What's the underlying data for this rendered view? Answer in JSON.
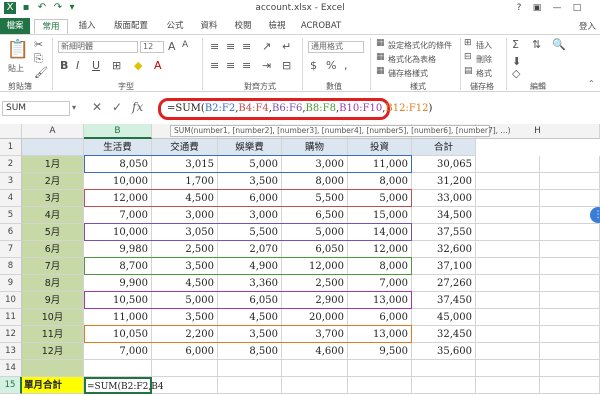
{
  "window": {
    "title": "account.xlsx - Excel",
    "controls": [
      "?",
      "▣",
      "—",
      "□"
    ],
    "signin": "登入"
  },
  "tabs": [
    "檔案",
    "常用",
    "插入",
    "版面配置",
    "公式",
    "資料",
    "校閱",
    "檢視",
    "ACROBAT"
  ],
  "ribbon": {
    "paste": "貼上",
    "font_name": "新細明體",
    "font_size": "12",
    "groups": [
      "剪貼簿",
      "字型",
      "對齊方式",
      "數值",
      "樣式",
      "儲存格",
      "編輯"
    ],
    "number_format": "通用格式",
    "styles": [
      "設定格式化的條件",
      "格式化為表格",
      "儲存格樣式"
    ],
    "cells": [
      "插入",
      "刪除",
      "格式"
    ],
    "edit_items": [
      "Σ",
      "排序與篩選",
      "尋找與選取"
    ]
  },
  "formula_bar": {
    "name_box": "SUM",
    "fx": "fx",
    "formula_parts": [
      {
        "text": "=SUM(",
        "color": "#222222"
      },
      {
        "text": "B2:F2",
        "color": "#3b6cc4"
      },
      {
        "text": ",",
        "color": "#222222"
      },
      {
        "text": "B4:F4",
        "color": "#c0504d"
      },
      {
        "text": ",",
        "color": "#222222"
      },
      {
        "text": "B6:F6",
        "color": "#7b4fb0"
      },
      {
        "text": ",",
        "color": "#222222"
      },
      {
        "text": "B8:F8",
        "color": "#4e9a3a"
      },
      {
        "text": ",",
        "color": "#222222"
      },
      {
        "text": "B10:F10",
        "color": "#9b3aa8"
      },
      {
        "text": ",",
        "color": "#222222"
      },
      {
        "text": "B12:F12",
        "color": "#e07a20"
      },
      {
        "text": ")",
        "color": "#222222"
      }
    ],
    "tooltip": "SUM(number1, [number2], [number3], [number4], [number5], [number6], [number7], ...)"
  },
  "grid": {
    "columns": [
      "A",
      "B",
      "C",
      "D",
      "E",
      "F",
      "G",
      "H"
    ],
    "selected_column": "B",
    "header": [
      "生活費",
      "交通費",
      "娛樂費",
      "購物",
      "投資",
      "合計"
    ],
    "rows": [
      {
        "label": "1月",
        "values": [
          "8,050",
          "3,015",
          "5,000",
          "3,000",
          "11,000",
          "30,065"
        ]
      },
      {
        "label": "2月",
        "values": [
          "10,000",
          "1,700",
          "3,500",
          "8,000",
          "8,000",
          "31,200"
        ]
      },
      {
        "label": "3月",
        "values": [
          "12,000",
          "4,500",
          "6,000",
          "5,500",
          "5,000",
          "33,000"
        ]
      },
      {
        "label": "4月",
        "values": [
          "7,000",
          "3,000",
          "3,000",
          "6,500",
          "15,000",
          "34,500"
        ]
      },
      {
        "label": "5月",
        "values": [
          "10,000",
          "3,050",
          "5,500",
          "5,000",
          "14,000",
          "37,550"
        ]
      },
      {
        "label": "6月",
        "values": [
          "9,980",
          "2,500",
          "2,070",
          "6,050",
          "12,000",
          "32,600"
        ]
      },
      {
        "label": "7月",
        "values": [
          "8,700",
          "3,500",
          "4,900",
          "12,000",
          "8,000",
          "37,100"
        ]
      },
      {
        "label": "8月",
        "values": [
          "9,900",
          "4,500",
          "3,360",
          "2,500",
          "7,000",
          "27,260"
        ]
      },
      {
        "label": "9月",
        "values": [
          "10,500",
          "5,000",
          "6,050",
          "2,900",
          "13,000",
          "37,450"
        ]
      },
      {
        "label": "10月",
        "values": [
          "11,000",
          "3,500",
          "4,500",
          "20,000",
          "6,000",
          "45,000"
        ]
      },
      {
        "label": "11月",
        "values": [
          "10,050",
          "2,200",
          "3,500",
          "3,700",
          "13,000",
          "32,450"
        ]
      },
      {
        "label": "12月",
        "values": [
          "7,000",
          "6,000",
          "8,500",
          "4,600",
          "9,500",
          "35,600"
        ]
      }
    ],
    "row_numbers": [
      "1",
      "2",
      "3",
      "4",
      "5",
      "6",
      "7",
      "8",
      "9",
      "10",
      "11",
      "12",
      "13",
      "14",
      "15"
    ],
    "total_label": "單月合計",
    "editing_cell": "=SUM(B2:F2,B4"
  }
}
